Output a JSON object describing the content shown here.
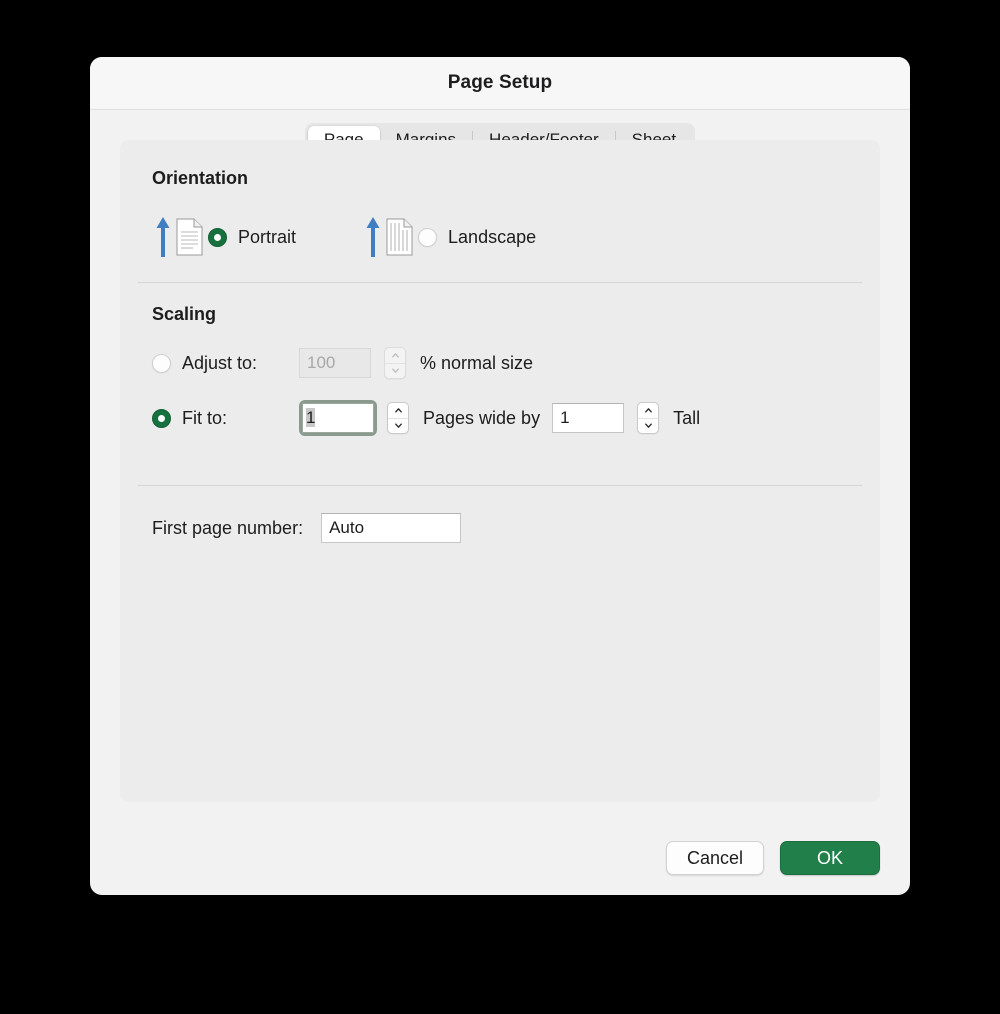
{
  "window": {
    "title": "Page Setup"
  },
  "tabs": [
    {
      "label": "Page",
      "selected": true
    },
    {
      "label": "Margins",
      "selected": false
    },
    {
      "label": "Header/Footer",
      "selected": false
    },
    {
      "label": "Sheet",
      "selected": false
    }
  ],
  "orientation": {
    "title": "Orientation",
    "portrait": {
      "label": "Portrait",
      "selected": true,
      "icon": "portrait-page-icon"
    },
    "landscape": {
      "label": "Landscape",
      "selected": false,
      "icon": "landscape-page-icon"
    }
  },
  "scaling": {
    "title": "Scaling",
    "adjust": {
      "label": "Adjust to:",
      "selected": false,
      "value": "100",
      "suffix": "% normal size"
    },
    "fit": {
      "label": "Fit to:",
      "selected": true,
      "wide_value": "1",
      "middle_label": "Pages wide by",
      "tall_value": "1",
      "tall_label": "Tall"
    }
  },
  "first_page": {
    "label": "First page number:",
    "value": "Auto"
  },
  "footer": {
    "cancel_label": "Cancel",
    "ok_label": "OK"
  },
  "colors": {
    "accent_green": "#21804a",
    "radio_green": "#17713f",
    "arrow_blue": "#3f7fc1",
    "dialog_bg": "#f2f2f2",
    "panel_bg": "#ececec",
    "titlebar_bg": "#f7f7f7"
  }
}
